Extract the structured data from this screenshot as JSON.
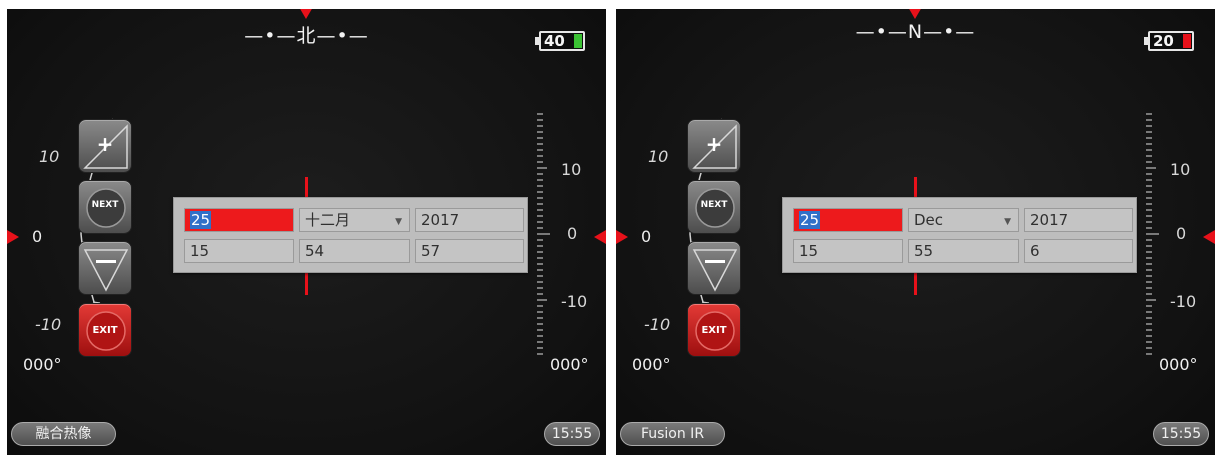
{
  "left_screen": {
    "compass_text": "—•—北—•—",
    "battery": {
      "level_text": "40",
      "fill_color": "#3bc234"
    },
    "left_scale": {
      "top_label": "10",
      "zero_label": "0",
      "bottom_label": "-10"
    },
    "right_scale": {
      "top_label": "10",
      "zero_label": "0",
      "bottom_label": "-10"
    },
    "heading_left": "000°",
    "heading_right": "000°",
    "buttons": {
      "plus": "+",
      "next": "NEXT",
      "exit": "EXIT"
    },
    "date_dialog": {
      "day": "25",
      "month": "十二月",
      "year": "2017",
      "hour": "15",
      "minute": "54",
      "second": "57"
    },
    "mode_label": "融合热像",
    "clock": "15:55"
  },
  "right_screen": {
    "compass_text": "—•—N—•—",
    "battery": {
      "level_text": "20",
      "fill_color": "#e8111a"
    },
    "left_scale": {
      "top_label": "10",
      "zero_label": "0",
      "bottom_label": "-10"
    },
    "right_scale": {
      "top_label": "10",
      "zero_label": "0",
      "bottom_label": "-10"
    },
    "heading_left": "000°",
    "heading_right": "000°",
    "buttons": {
      "plus": "+",
      "next": "NEXT",
      "exit": "EXIT"
    },
    "date_dialog": {
      "day": "25",
      "month": "Dec",
      "year": "2017",
      "hour": "15",
      "minute": "55",
      "second": "6"
    },
    "mode_label": "Fusion IR",
    "clock": "15:55"
  },
  "colors": {
    "accent_red": "#e8111a",
    "selection_blue": "#3070c8"
  }
}
